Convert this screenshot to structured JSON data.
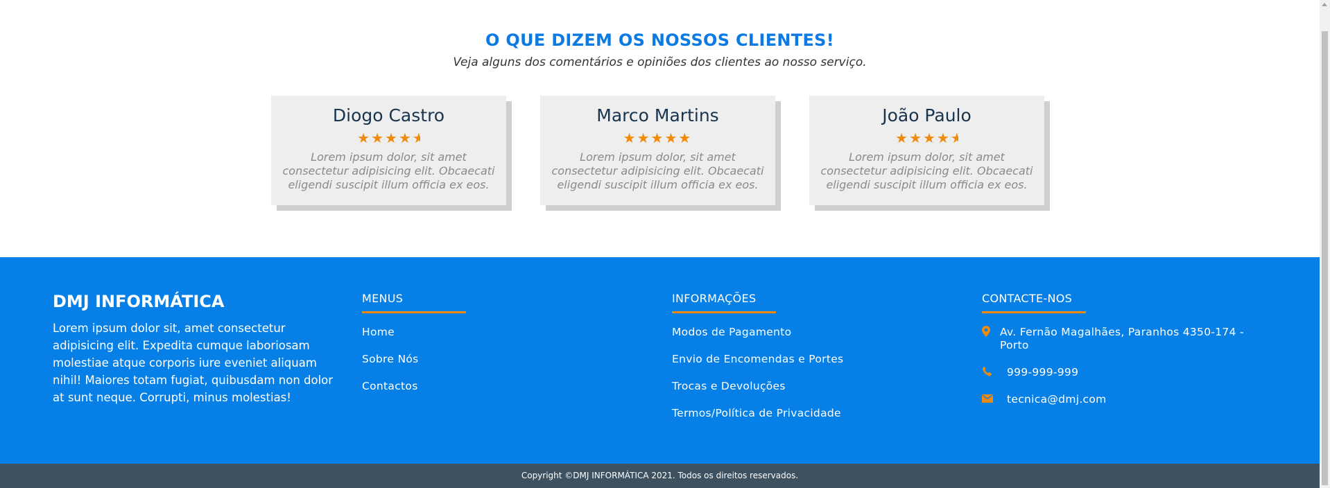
{
  "testimonials": {
    "title": "O QUE DIZEM OS NOSSOS CLIENTES!",
    "subtitle": "Veja alguns dos comentários e opiniões dos clientes ao nosso serviço.",
    "cards": [
      {
        "name": "Diogo Castro",
        "rating": 4.5,
        "text": "Lorem ipsum dolor, sit amet consectetur adipisicing elit. Obcaecati eligendi suscipit illum officia ex eos."
      },
      {
        "name": "Marco Martins",
        "rating": 5,
        "text": "Lorem ipsum dolor, sit amet consectetur adipisicing elit. Obcaecati eligendi suscipit illum officia ex eos."
      },
      {
        "name": "João Paulo",
        "rating": 4.5,
        "text": "Lorem ipsum dolor, sit amet consectetur adipisicing elit. Obcaecati eligendi suscipit illum officia ex eos."
      }
    ],
    "star_color": "#f08a0c"
  },
  "footer": {
    "brand": "DMJ INFORMÁTICA",
    "about": "Lorem ipsum dolor sit, amet consectetur adipisicing elit. Expedita cumque laboriosam molestiae atque corporis iure eveniet aliquam nihil! Maiores totam fugiat, quibusdam non dolor at sunt neque. Corrupti, minus molestias!",
    "menus": {
      "title": "MENUS",
      "items": [
        "Home",
        "Sobre Nós",
        "Contactos"
      ]
    },
    "info": {
      "title": "INFORMAÇÕES",
      "items": [
        "Modos de Pagamento",
        "Envio de Encomendas e Portes",
        "Trocas e Devoluções",
        "Termos/Política de Privacidade"
      ]
    },
    "contact": {
      "title": "CONTACTE-NOS",
      "address": "Av. Fernão Magalhães, Paranhos 4350-174 - Porto",
      "phone": "999-999-999",
      "email": "tecnica@dmj.com",
      "icons": {
        "address": "map-marker-icon",
        "phone": "phone-icon",
        "email": "envelope-icon"
      }
    },
    "background": "#0680e6",
    "accent": "#f08a0c"
  },
  "copyright": "Copyright ©DMJ INFORMÁTICA 2021. Todos os direitos reservados."
}
